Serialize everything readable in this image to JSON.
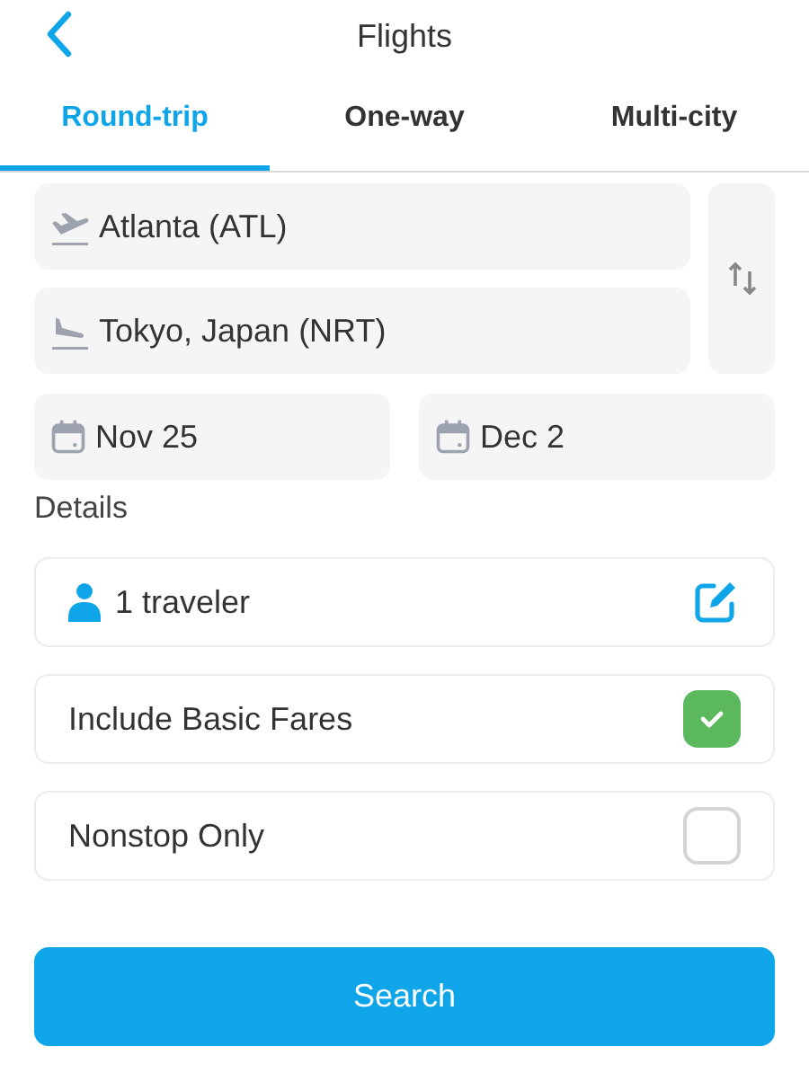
{
  "header": {
    "title": "Flights"
  },
  "tabs": [
    {
      "label": "Round-trip",
      "selected": true
    },
    {
      "label": "One-way",
      "selected": false
    },
    {
      "label": "Multi-city",
      "selected": false
    }
  ],
  "route": {
    "origin": "Atlanta (ATL)",
    "destination": "Tokyo, Japan (NRT)"
  },
  "dates": [
    "Nov 25",
    "Dec 2"
  ],
  "details": {
    "label": "Details",
    "options": [
      {
        "kind": "travelers",
        "label": "1 traveler"
      },
      {
        "kind": "checkbox",
        "label": "Include Basic Fares",
        "checked": true
      },
      {
        "kind": "checkbox",
        "label": "Nonstop Only",
        "checked": false
      }
    ]
  },
  "search_button": "Search"
}
